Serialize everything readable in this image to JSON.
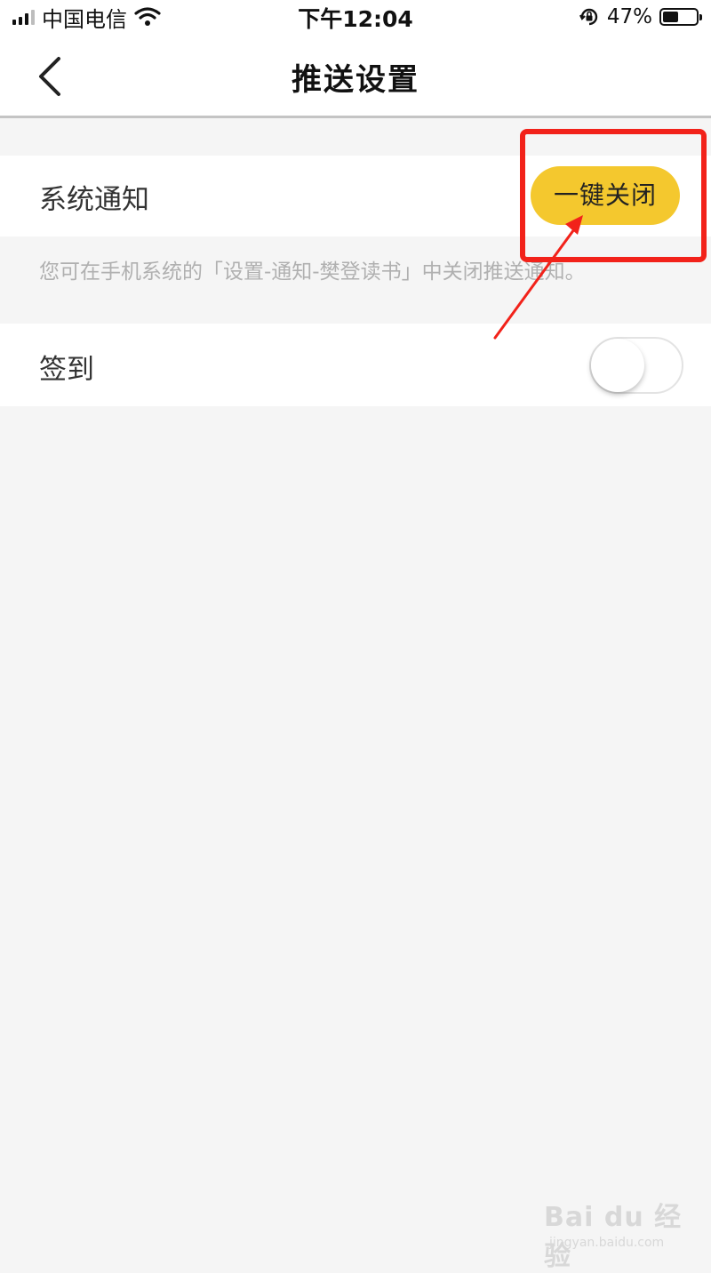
{
  "status_bar": {
    "carrier": "中国电信",
    "time": "下午12:04",
    "battery_text": "47%",
    "battery_level": 0.47
  },
  "nav": {
    "title": "推送设置"
  },
  "system_notice": {
    "label": "系统通知",
    "button_label": "一键关闭",
    "hint": "您可在手机系统的「设置-通知-樊登读书」中关闭推送通知。"
  },
  "signin": {
    "label": "签到",
    "toggle_on": false
  },
  "watermark": {
    "text": "Bai du 经验",
    "url": "jingyan.baidu.com"
  },
  "colors": {
    "accent_yellow": "#f4c82e",
    "annotation_red": "#f2221a",
    "background": "#f5f5f5"
  }
}
